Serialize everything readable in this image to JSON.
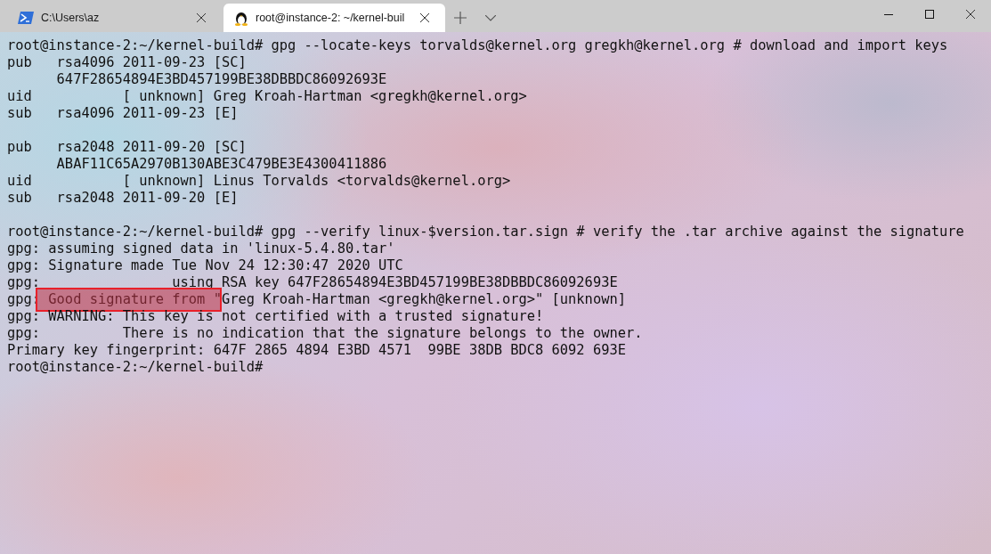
{
  "tabs": [
    {
      "title": "C:\\Users\\az",
      "kind": "powershell",
      "selected": false
    },
    {
      "title": "root@instance-2: ~/kernel-buil",
      "kind": "linux",
      "selected": true
    }
  ],
  "terminal": {
    "blocks": [
      {
        "lines": [
          "root@instance-2:~/kernel-build# gpg --locate-keys torvalds@kernel.org gregkh@kernel.org # download and import keys",
          "pub   rsa4096 2011-09-23 [SC]",
          "      647F28654894E3BD457199BE38DBBDC86092693E",
          "uid           [ unknown] Greg Kroah-Hartman <gregkh@kernel.org>",
          "sub   rsa4096 2011-09-23 [E]"
        ]
      },
      {
        "lines": [
          "pub   rsa2048 2011-09-20 [SC]",
          "      ABAF11C65A2970B130ABE3C479BE3E4300411886",
          "uid           [ unknown] Linus Torvalds <torvalds@kernel.org>",
          "sub   rsa2048 2011-09-20 [E]"
        ]
      },
      {
        "lines": [
          "root@instance-2:~/kernel-build# gpg --verify linux-$version.tar.sign # verify the .tar archive against the signature",
          "gpg: assuming signed data in 'linux-5.4.80.tar'",
          "gpg: Signature made Tue Nov 24 12:30:47 2020 UTC",
          "gpg:                using RSA key 647F28654894E3BD457199BE38DBBDC86092693E",
          {
            "kind": "annotated",
            "before": "gpg:",
            "marked": " Good signature from \"",
            "after": "Greg Kroah-Hartman <gregkh@kernel.org>\" [unknown]"
          },
          "gpg: WARNING: This key is not certified with a trusted signature!",
          "gpg:          There is no indication that the signature belongs to the owner.",
          "Primary key fingerprint: 647F 2865 4894 E3BD 4571  99BE 38DB BDC8 6092 693E",
          "root@instance-2:~/kernel-build#"
        ]
      }
    ]
  }
}
